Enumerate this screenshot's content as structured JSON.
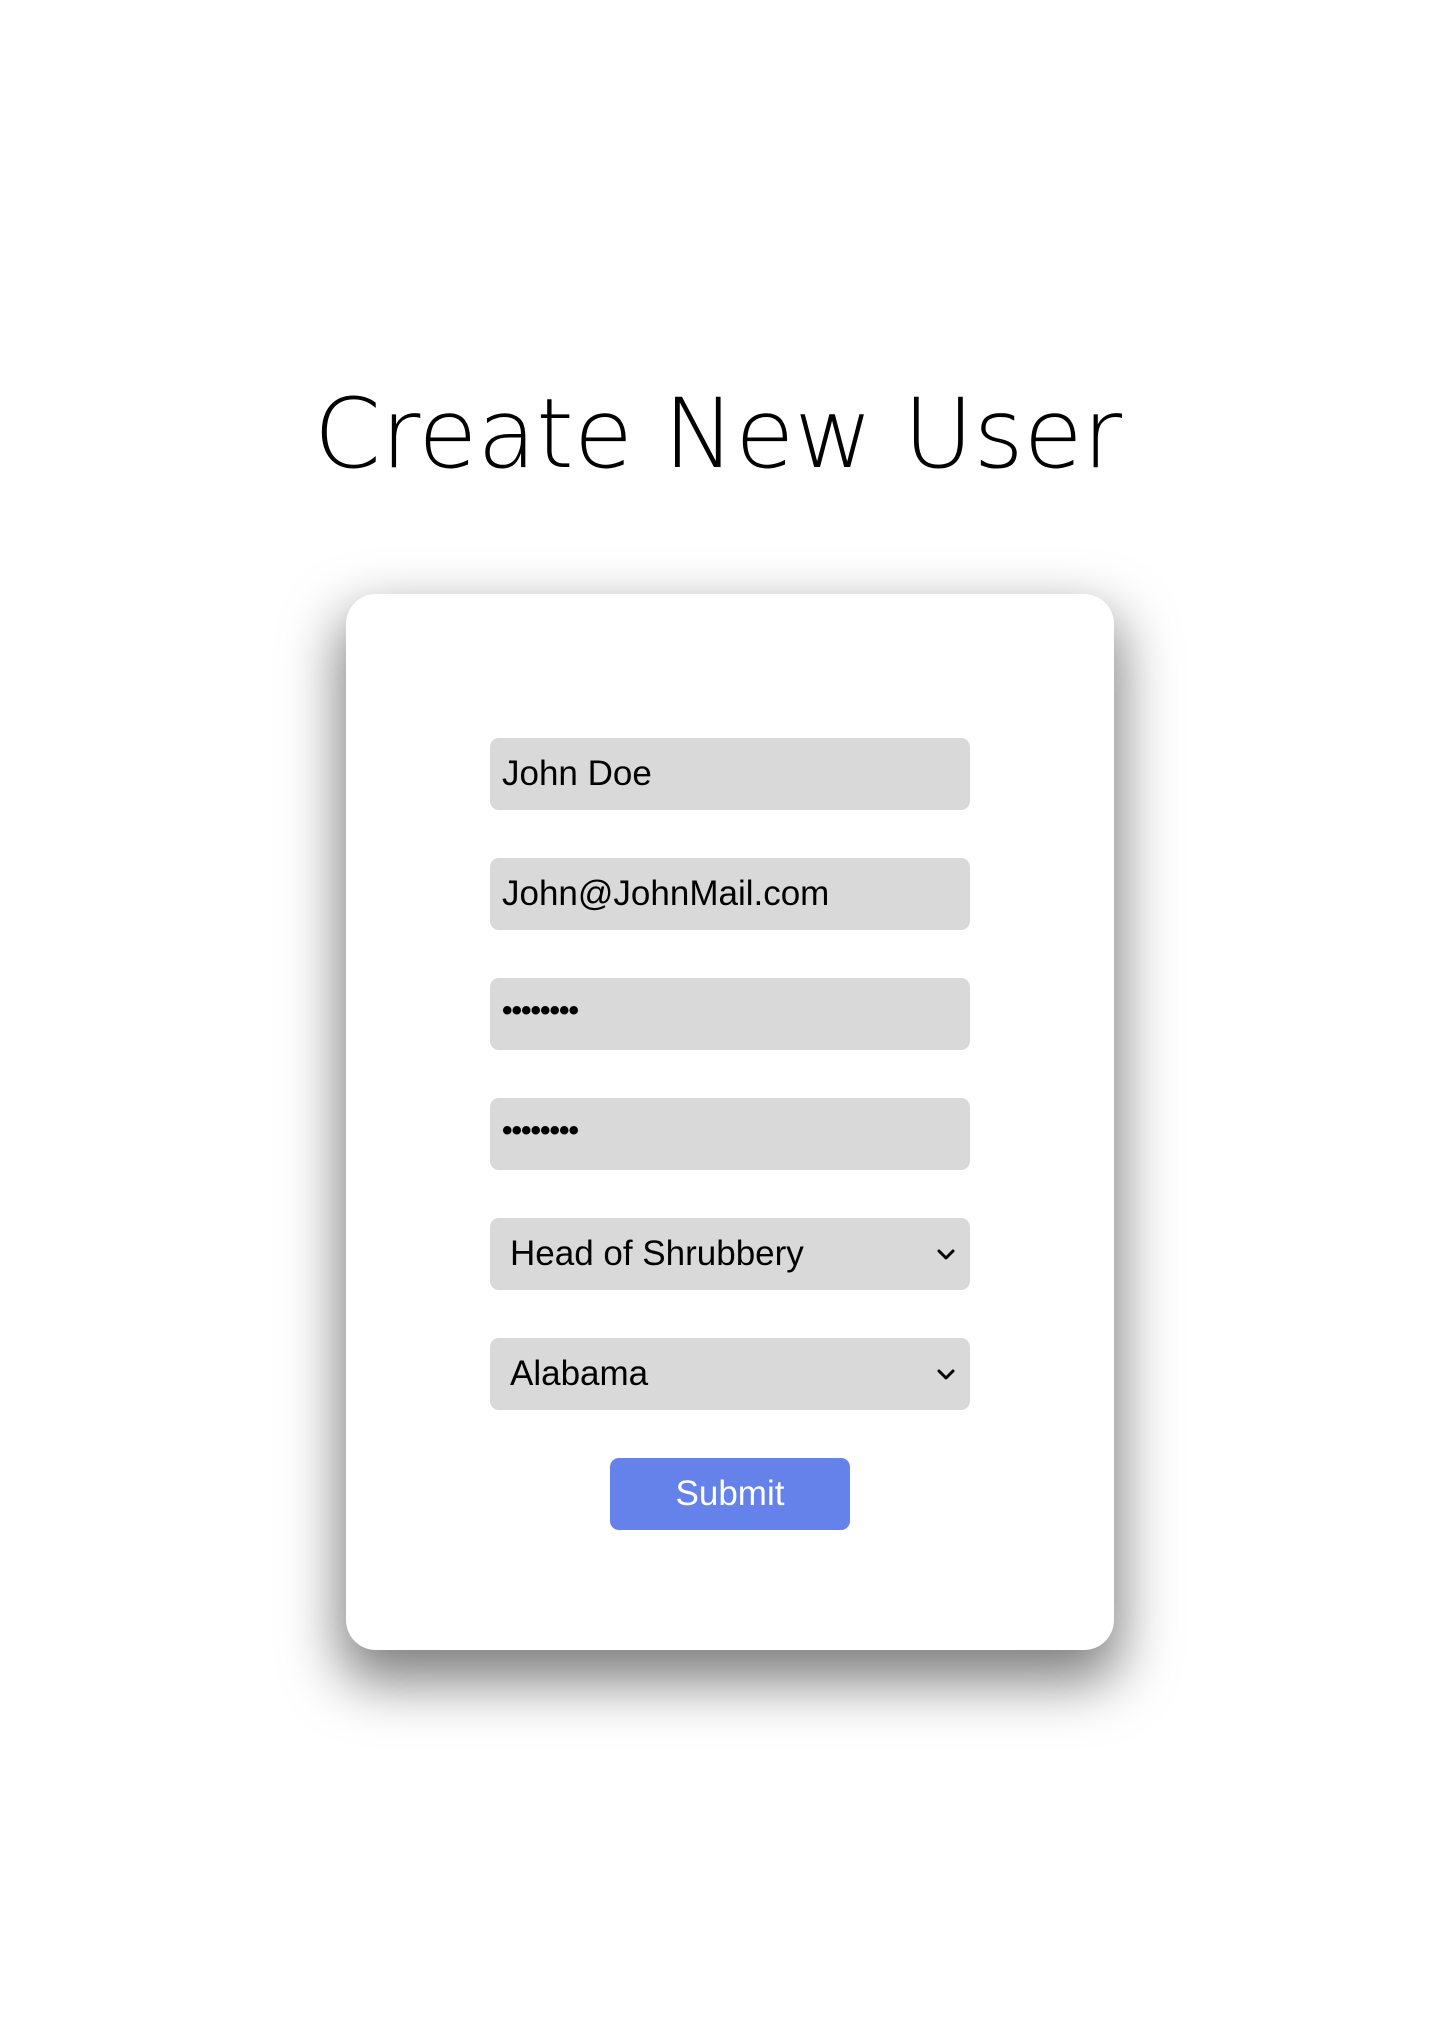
{
  "page": {
    "title": "Create New User"
  },
  "form": {
    "name": {
      "value": "John Doe"
    },
    "email": {
      "value": "John@JohnMail.com"
    },
    "password": {
      "masked_value": "••••••••"
    },
    "confirm_password": {
      "masked_value": "••••••••"
    },
    "role": {
      "selected": "Head of Shrubbery"
    },
    "state": {
      "selected": "Alabama"
    },
    "submit_label": "Submit"
  },
  "colors": {
    "background": "#ffffff",
    "card": "#ffffff",
    "field_background": "#d9d9d9",
    "submit_background": "#6482ea",
    "submit_text": "#ffffff",
    "text": "#000000"
  },
  "icons": {
    "select_arrow": "chevron-down-icon"
  }
}
